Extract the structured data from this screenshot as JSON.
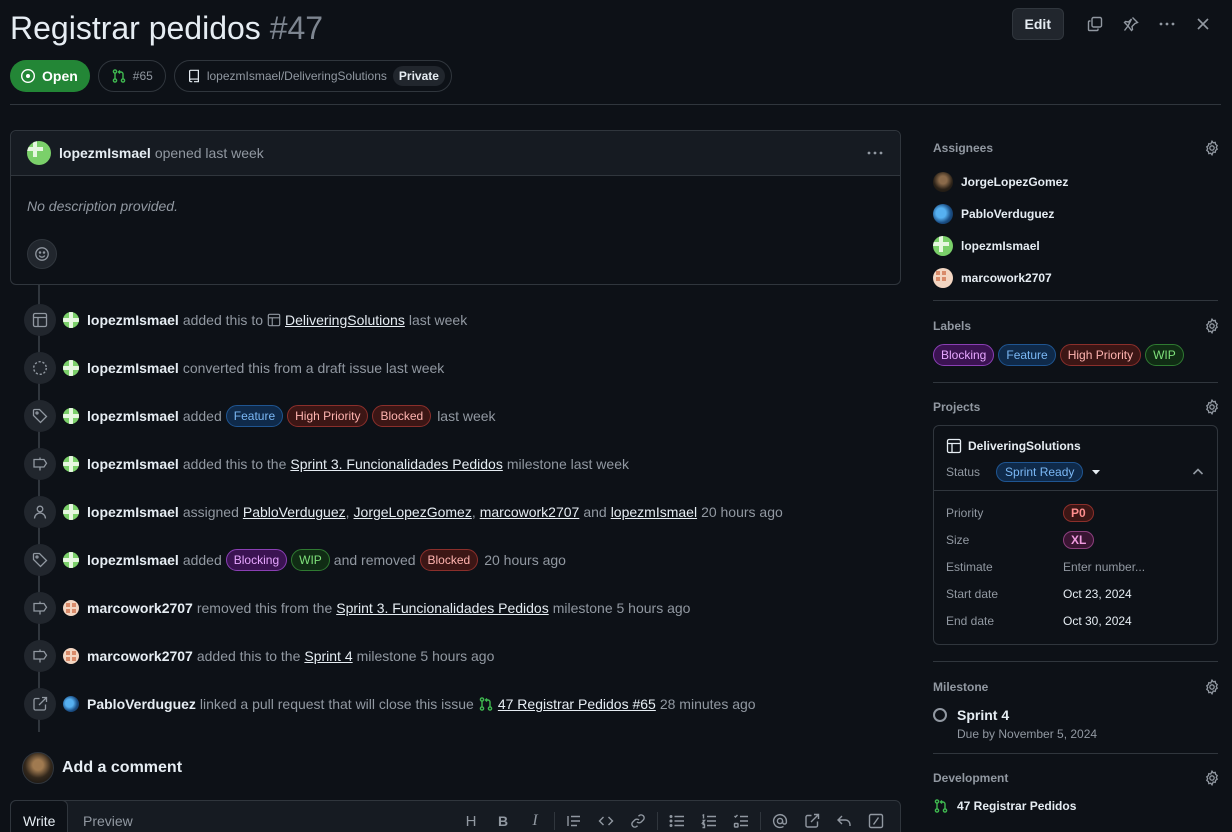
{
  "issue": {
    "title": "Registrar pedidos",
    "number": "#47",
    "state": "Open",
    "linked_pr": "#65",
    "repo": "lopezmIsmael/DeliveringSolutions",
    "visibility": "Private"
  },
  "header_actions": {
    "edit_label": "Edit"
  },
  "comment": {
    "author": "lopezmIsmael",
    "action": "opened last week",
    "body": "No description provided."
  },
  "timeline": [
    {
      "who": "lopezmIsmael",
      "parts": [
        "added this to"
      ],
      "link": "DeliveringSolutions",
      "tail": "last week"
    },
    {
      "who": "lopezmIsmael",
      "text": "converted this from a draft issue last week"
    },
    {
      "who": "lopezmIsmael",
      "text1": "added",
      "labels": [
        "Feature",
        "High Priority",
        "Blocked"
      ],
      "tail": "last week"
    },
    {
      "who": "lopezmIsmael",
      "text1": "added this to the",
      "link": "Sprint 3. Funcionalidades Pedidos",
      "tail": "milestone last week"
    },
    {
      "who": "lopezmIsmael",
      "text1": "assigned",
      "users": [
        "PabloVerduguez",
        "JorgeLopezGomez",
        "marcowork2707",
        "lopezmIsmael"
      ],
      "sep1": ",",
      "and": "and",
      "tail": "20 hours ago"
    },
    {
      "who": "lopezmIsmael",
      "text1": "added",
      "labels": [
        "Blocking",
        "WIP"
      ],
      "text2": "and removed",
      "removed": "Blocked",
      "tail": "20 hours ago"
    },
    {
      "who": "marcowork2707",
      "text1": "removed this from the",
      "link": "Sprint 3. Funcionalidades Pedidos",
      "tail": "milestone 5 hours ago"
    },
    {
      "who": "marcowork2707",
      "text1": "added this to the",
      "link": "Sprint 4",
      "tail": "milestone 5 hours ago"
    },
    {
      "who": "PabloVerduguez",
      "text1": "linked a pull request that will close this issue",
      "link": "47 Registrar Pedidos #65",
      "tail": "28 minutes ago"
    }
  ],
  "add_comment": {
    "label": "Add a comment",
    "tabs": [
      "Write",
      "Preview"
    ],
    "toolbar": [
      "H",
      "B",
      "I"
    ]
  },
  "sidebar": {
    "assignees_title": "Assignees",
    "assignees": [
      "JorgeLopezGomez",
      "PabloVerduguez",
      "lopezmIsmael",
      "marcowork2707"
    ],
    "labels_title": "Labels",
    "labels": [
      "Blocking",
      "Feature",
      "High Priority",
      "WIP"
    ],
    "projects_title": "Projects",
    "project": {
      "name": "DeliveringSolutions",
      "status_label": "Status",
      "status_value": "Sprint Ready",
      "fields": [
        {
          "key": "Priority",
          "value": "P0"
        },
        {
          "key": "Size",
          "value": "XL"
        },
        {
          "key": "Estimate",
          "value": "Enter number..."
        },
        {
          "key": "Start date",
          "value": "Oct 23, 2024"
        },
        {
          "key": "End date",
          "value": "Oct 30, 2024"
        }
      ]
    },
    "milestone_title": "Milestone",
    "milestone_name": "Sprint 4",
    "milestone_due": "Due by November 5, 2024",
    "development_title": "Development",
    "development_item": "47 Registrar Pedidos"
  },
  "colors": {
    "background": "#0d1117",
    "open_green": "#238636",
    "border": "#30363d",
    "muted_text": "#9198a1"
  }
}
